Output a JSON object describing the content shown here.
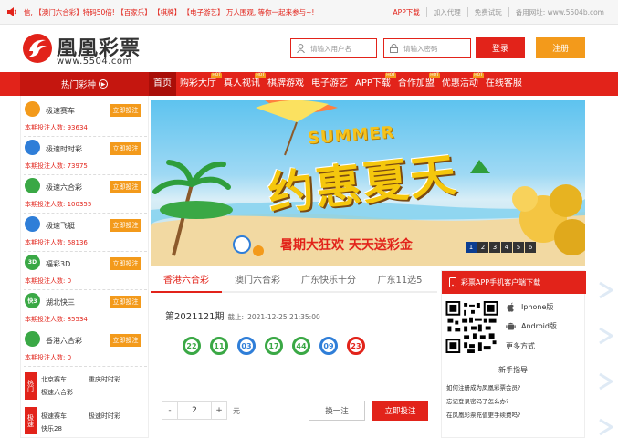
{
  "topbar": {
    "announcement": "信, 【澳门六合彩】特码50倍! 【百家乐】 【棋牌】 【电子游艺】 万人围观, 等你一起来参与~!",
    "links": [
      "APP下载",
      "加入代理",
      "免费试玩",
      "备用网址: www.5504b.com"
    ]
  },
  "header": {
    "logo_name": "凰凰彩票",
    "logo_url": "www.5504.com",
    "username_placeholder": "请输入用户名",
    "password_placeholder": "请输入密码",
    "login_label": "登录",
    "register_label": "注册"
  },
  "nav": {
    "hot_label": "热门彩种",
    "items": [
      {
        "label": "首页",
        "tag": ""
      },
      {
        "label": "购彩大厅",
        "tag": "HOT"
      },
      {
        "label": "真人视讯",
        "tag": "HOT"
      },
      {
        "label": "棋牌游戏",
        "tag": ""
      },
      {
        "label": "电子游艺",
        "tag": ""
      },
      {
        "label": "APP下载",
        "tag": "HOT"
      },
      {
        "label": "合作加盟",
        "tag": "HOT"
      },
      {
        "label": "优惠活动",
        "tag": "HOT"
      },
      {
        "label": "在线客服",
        "tag": ""
      }
    ]
  },
  "sidebar": {
    "lotteries": [
      {
        "name": "极速赛车",
        "bet_label": "立即投注",
        "count_text": "本期投注人数: 93634",
        "color": "#f39a1b",
        "icon_text": ""
      },
      {
        "name": "极速时时彩",
        "bet_label": "立即投注",
        "count_text": "本期投注人数: 73975",
        "color": "#2f7ed8",
        "icon_text": ""
      },
      {
        "name": "极速六合彩",
        "bet_label": "立即投注",
        "count_text": "本期投注人数: 100355",
        "color": "#3aa845",
        "icon_text": ""
      },
      {
        "name": "极速飞艇",
        "bet_label": "立即投注",
        "count_text": "本期投注人数: 68136",
        "color": "#2f7ed8",
        "icon_text": ""
      },
      {
        "name": "福彩3D",
        "bet_label": "立即投注",
        "count_text": "本期投注人数: 0",
        "color": "#3aa845",
        "icon_text": "3D"
      },
      {
        "name": "湖北快三",
        "bet_label": "立即投注",
        "count_text": "本期投注人数: 85534",
        "color": "#3aa845",
        "icon_text": "快3"
      },
      {
        "name": "香港六合彩",
        "bet_label": "立即投注",
        "count_text": "本期投注人数: 0",
        "color": "#3aa845",
        "icon_text": ""
      }
    ],
    "hot_group": {
      "label": "热门",
      "items": [
        "北京赛车",
        "重庆时时彩",
        "极速六合彩"
      ]
    },
    "fast_group": {
      "label": "极速",
      "items": [
        "极速赛车",
        "极速时时彩",
        "快乐28"
      ]
    }
  },
  "banner": {
    "summer": "SUMMER",
    "headline": "约惠夏天",
    "slogan": "暑期大狂欢 天天送彩金",
    "pages": [
      "1",
      "2",
      "3",
      "4",
      "5",
      "6"
    ]
  },
  "tabs": [
    "香港六合彩",
    "澳门六合彩",
    "广东快乐十分",
    "广东11选5"
  ],
  "draw": {
    "issue": "第2021121期",
    "deadline_label": "截止:",
    "deadline": "2021-12-25 21:35:00",
    "balls": [
      {
        "n": "22",
        "color": "#3aa845"
      },
      {
        "n": "11",
        "color": "#3aa845"
      },
      {
        "n": "03",
        "color": "#2f7ed8"
      },
      {
        "n": "17",
        "color": "#3aa845"
      },
      {
        "n": "44",
        "color": "#3aa845"
      },
      {
        "n": "09",
        "color": "#2f7ed8"
      },
      {
        "n": "23",
        "color": "#e2231a"
      }
    ],
    "minus": "-",
    "amount": "2",
    "plus": "+",
    "unit": "元",
    "random_label": "换一注",
    "bet_label": "立即投注"
  },
  "app_panel": {
    "title": "彩票APP手机客户端下载",
    "iphone": "Iphone版",
    "android": "Android版",
    "more": "更多方式",
    "guide": "新手指导",
    "questions": [
      "如何注册成为凤凰彩票会员?",
      "忘记登录密码了怎么办?",
      "在凤凰彩票充值更手续费吗?"
    ]
  }
}
